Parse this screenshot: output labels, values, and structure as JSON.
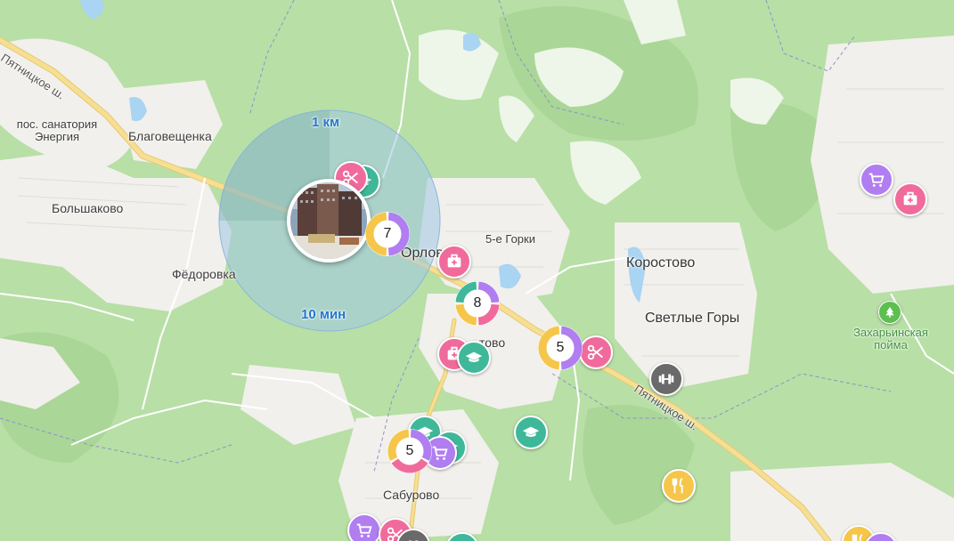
{
  "map": {
    "radius": {
      "distance": "1 км",
      "time": "10 мин"
    },
    "places": [
      {
        "key": "pyatnitskoe1",
        "text": "Пятницкое ш.",
        "kind": "road"
      },
      {
        "key": "sanatorium",
        "text": "пос. санатория\nЭнергия",
        "kind": "vil"
      },
      {
        "key": "blagoveshchenka",
        "text": "Благовещенка",
        "kind": "vil"
      },
      {
        "key": "bolshakovo",
        "text": "Большаково",
        "kind": "vil"
      },
      {
        "key": "fedorovka",
        "text": "Фёдоровка",
        "kind": "vil"
      },
      {
        "key": "orlovo",
        "text": "Орлово",
        "kind": "town"
      },
      {
        "key": "gorki5",
        "text": "5-е Горки",
        "kind": "vil"
      },
      {
        "key": "korostovo",
        "text": "Коростово",
        "kind": "town"
      },
      {
        "key": "svetlye",
        "text": "Светлые Горы",
        "kind": "town"
      },
      {
        "key": "tovo",
        "text": "тово",
        "kind": "vil"
      },
      {
        "key": "pyatnitskoe2",
        "text": "Пятницкое ш.",
        "kind": "road"
      },
      {
        "key": "saburovo",
        "text": "Сабурово",
        "kind": "vil"
      },
      {
        "key": "zakharinskaya",
        "text": "Захарьинская\nпойма",
        "kind": "park"
      }
    ],
    "clusters": [
      {
        "key": "c7",
        "count": "7",
        "colors": [
          "#b07ef0",
          "#f5c64a"
        ]
      },
      {
        "key": "c8",
        "count": "8",
        "colors": [
          "#b07ef0",
          "#f06b9b",
          "#f5c64a",
          "#3fb89a"
        ]
      },
      {
        "key": "c5a",
        "count": "5",
        "colors": [
          "#b07ef0",
          "#f5c64a"
        ]
      },
      {
        "key": "c5b",
        "count": "5",
        "colors": [
          "#b07ef0",
          "#f06b9b",
          "#f5c64a"
        ]
      }
    ],
    "poi_types": {
      "salon": {
        "icon": "scissors-icon",
        "color": "#f06b9b"
      },
      "clinic": {
        "icon": "medical-kit-icon",
        "color": "#f06b9b"
      },
      "school": {
        "icon": "graduation-cap-icon",
        "color": "#3fb89a"
      },
      "shop": {
        "icon": "shopping-cart-icon",
        "color": "#b07ef0"
      },
      "gym": {
        "icon": "dumbbell-icon",
        "color": "#6a6a6a"
      },
      "food": {
        "icon": "fork-knife-icon",
        "color": "#f5c64a"
      },
      "park": {
        "icon": "tree-icon",
        "color": "#5cbf50"
      }
    }
  }
}
